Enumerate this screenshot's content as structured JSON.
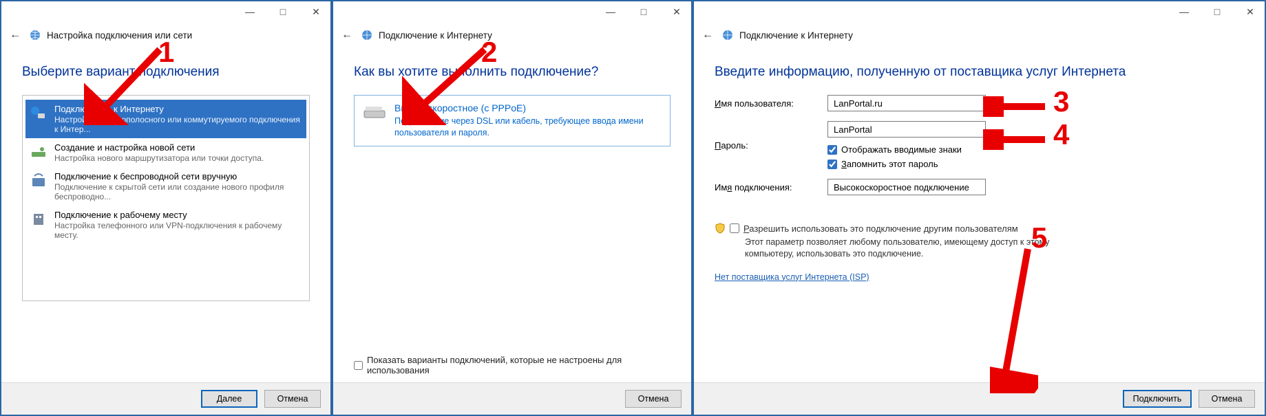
{
  "window1": {
    "titlebar": {
      "minimize": "—",
      "maximize": "□",
      "close": "✕"
    },
    "header": "Настройка подключения или сети",
    "heading": "Выберите вариант подключения",
    "options": [
      {
        "title": "Подключение к Интернету",
        "desc": "Настройка широкополосного или коммутируемого подключения к Интер..."
      },
      {
        "title": "Создание и настройка новой сети",
        "desc": "Настройка нового маршрутизатора или точки доступа."
      },
      {
        "title": "Подключение к беспроводной сети вручную",
        "desc": "Подключение к скрытой сети или создание нового профиля беспроводно..."
      },
      {
        "title": "Подключение к рабочему месту",
        "desc": "Настройка телефонного или VPN-подключения к рабочему месту."
      }
    ],
    "btn_next": "Далее",
    "btn_cancel": "Отмена",
    "annotation_num": "1"
  },
  "window2": {
    "titlebar": {
      "minimize": "—",
      "maximize": "□",
      "close": "✕"
    },
    "header": "Подключение к Интернету",
    "heading": "Как вы хотите выполнить подключение?",
    "pppoe_title": "Высокоскоростное (с PPPoE)",
    "pppoe_desc": "Подключение через DSL или кабель, требующее ввода имени пользователя и пароля.",
    "show_unconfigured": "Показать варианты подключений, которые не настроены для использования",
    "btn_cancel": "Отмена",
    "annotation_num": "2"
  },
  "window3": {
    "titlebar": {
      "minimize": "—",
      "maximize": "□",
      "close": "✕"
    },
    "header": "Подключение к Интернету",
    "heading": "Введите информацию, полученную от поставщика услуг Интернета",
    "label_user": "Имя пользователя:",
    "val_user": "LanPortal.ru",
    "label_pass": "Пароль:",
    "val_pass": "LanPortal",
    "chk_show": "Отображать вводимые знаки",
    "chk_remember": "Запомнить этот пароль",
    "label_conn": "Имя подключения:",
    "val_conn": "Высокоскоростное подключение",
    "perm_label": "Разрешить использовать это подключение другим пользователям",
    "perm_desc": "Этот параметр позволяет любому пользователю, имеющему доступ к этому компьютеру, использовать это подключение.",
    "isp_link": "Нет поставщика услуг Интернета (ISP)",
    "btn_connect": "Подключить",
    "btn_cancel": "Отмена",
    "annotation_nums": {
      "user": "3",
      "pass": "4",
      "connect": "5"
    }
  }
}
